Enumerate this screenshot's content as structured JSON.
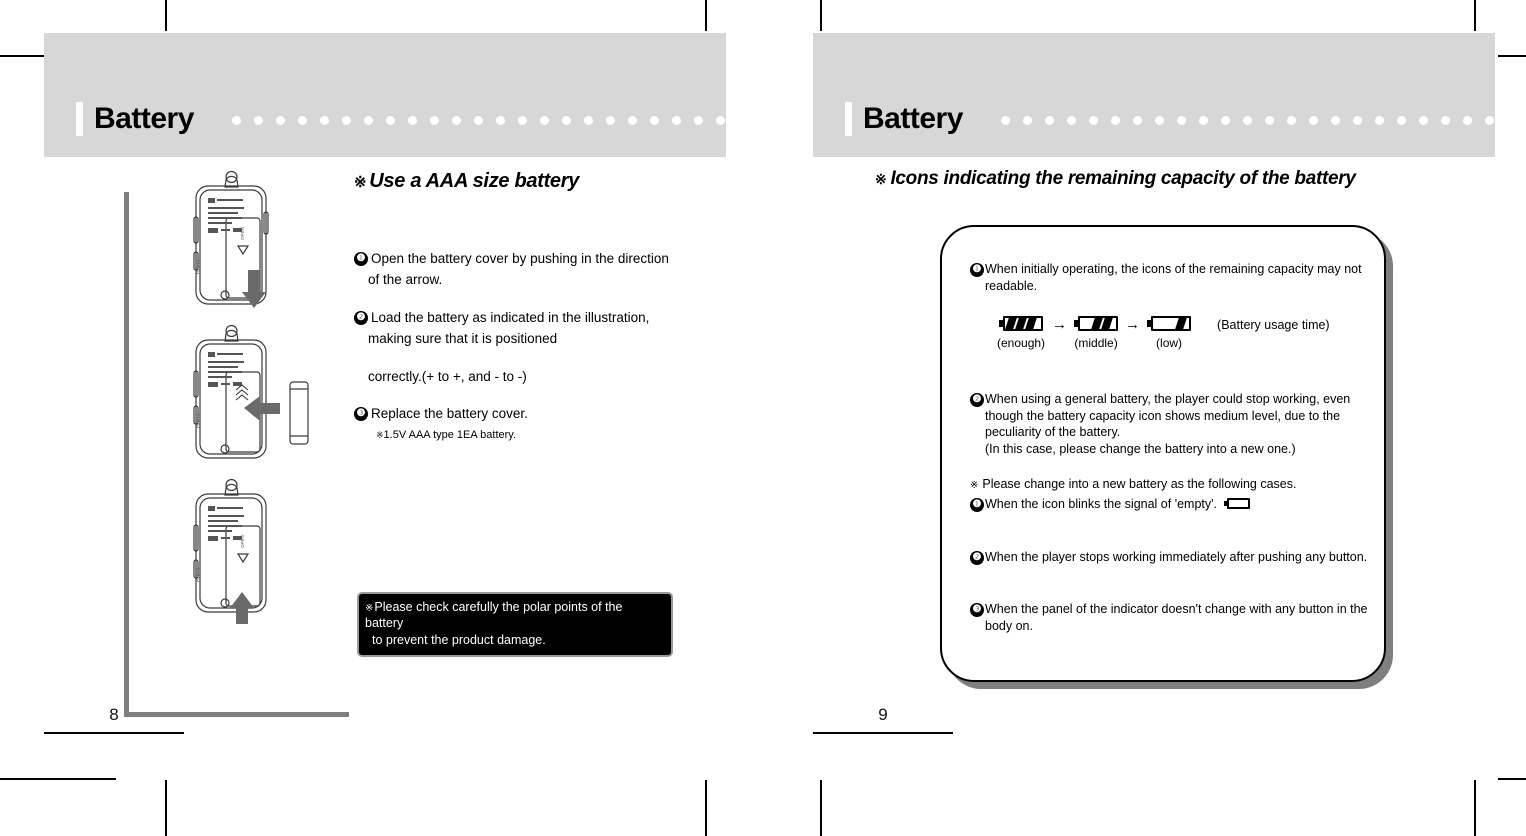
{
  "spread": {
    "left_page": {
      "header": {
        "title": "Battery",
        "dot_count": 25
      },
      "page_number": "8",
      "section": {
        "mark": "※",
        "heading": "Use a AAA size battery"
      },
      "steps": [
        {
          "num": "❶",
          "line1": "Open the battery cover by pushing in the direction",
          "line2": "of the arrow."
        },
        {
          "num": "❷",
          "line1": "Load the battery as indicated in the illustration,",
          "line2": "making sure that it is positioned",
          "line3": "correctly.(+ to +, and - to -)"
        },
        {
          "num": "❸",
          "line1": "Replace the battery cover."
        }
      ],
      "small_note": {
        "mark": "※",
        "text": "1.5V AAA type 1EA battery."
      },
      "warning": {
        "mark": "※",
        "line1": "Please check carefully the polar points of the battery",
        "line2": "to prevent the product damage."
      },
      "illustrations": [
        {
          "name": "player-back-open-cover",
          "arrow": "down"
        },
        {
          "name": "player-back-insert-battery",
          "arrow": "left"
        },
        {
          "name": "player-back-replace-cover",
          "arrow": "up"
        }
      ]
    },
    "right_page": {
      "header": {
        "title": "Battery",
        "dot_count": 25
      },
      "page_number": "9",
      "section": {
        "mark": "※",
        "heading": "Icons indicating the remaining capacity of the battery"
      },
      "box": {
        "items": [
          {
            "num": "❶",
            "lines": [
              "When initially operating, the icons of the remaining capacity may not",
              "readable."
            ]
          },
          {
            "num": "❷",
            "lines": [
              "When using a general battery, the player could stop working, even",
              "though the battery capacity icon shows medium level, due to the",
              "peculiarity of the battery.",
              "(In this case, please change the battery into a new one.)"
            ]
          }
        ],
        "battery_icons": {
          "states": [
            {
              "label": "(enough)",
              "segments": 3
            },
            {
              "label": "(middle)",
              "segments": 2
            },
            {
              "label": "(low)",
              "segments": 1
            }
          ],
          "arrow": "→",
          "usage_label": "(Battery usage time)"
        },
        "note": {
          "mark": "※",
          "text": "Please change into a new battery as the following cases."
        },
        "cases": [
          {
            "num": "❶",
            "text": "When the icon blinks the signal of 'empty'.",
            "has_empty_icon": true
          },
          {
            "num": "❷",
            "text": "When the player stops working immediately after pushing any button.",
            "has_empty_icon": false
          },
          {
            "num": "❸",
            "text": "When the panel of the indicator doesn't change with any button  in the",
            "text2": "body on.",
            "has_empty_icon": false
          }
        ]
      }
    }
  },
  "colors": {
    "header_band": "#d7d7d7",
    "rule_gray": "#7f7f7f",
    "warning_bg": "#000000",
    "warning_border": "#9a9a9a"
  }
}
